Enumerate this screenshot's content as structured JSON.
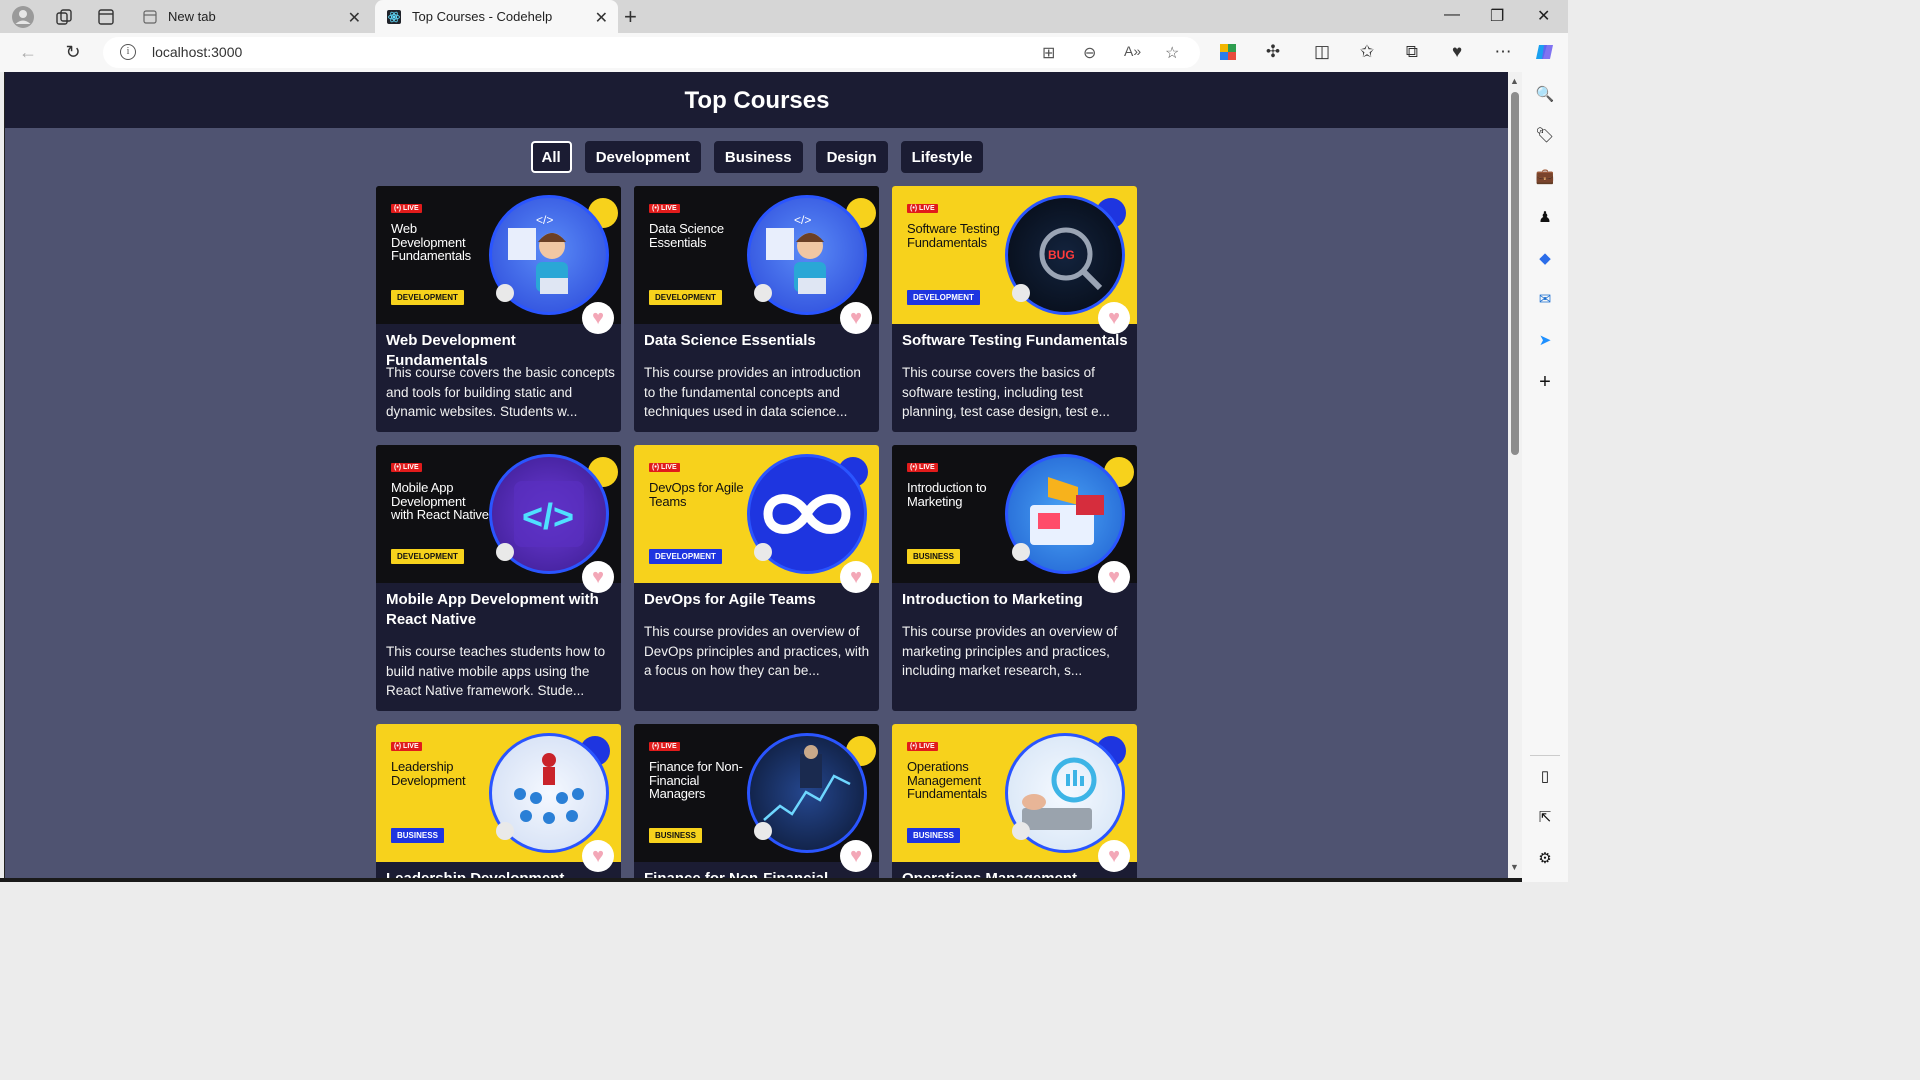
{
  "browser": {
    "tabs": [
      {
        "label": "New tab",
        "favicon": "new-tab-icon"
      },
      {
        "label": "Top Courses - Codehelp",
        "favicon": "react-icon",
        "active": true
      }
    ],
    "url": "localhost:3000"
  },
  "page": {
    "title": "Top Courses",
    "filters": [
      "All",
      "Development",
      "Business",
      "Design",
      "Lifestyle"
    ],
    "active_filter": "All",
    "live_label": "(•) LIVE",
    "like_symbol": "♥"
  },
  "courses": [
    {
      "thumb_title": "Web Development Fundamentals",
      "badge": "DEVELOPMENT",
      "title": "Web Development Fundamentals",
      "description": "This course covers the basic concepts and tools for building static and dynamic websites. Students w..."
    },
    {
      "thumb_title": "Data Science Essentials",
      "badge": "DEVELOPMENT",
      "title": "Data Science Essentials",
      "description": "This course provides an introduction to the fundamental concepts and techniques used in data science..."
    },
    {
      "thumb_title": "Software Testing Fundamentals",
      "badge": "DEVELOPMENT",
      "title": "Software Testing Fundamentals",
      "description": "This course covers the basics of software testing, including test planning, test case design, test e..."
    },
    {
      "thumb_title": "Mobile App Development with React Native",
      "badge": "DEVELOPMENT",
      "title": "Mobile App Development with React Native",
      "description": "This course teaches students how to build native mobile apps using the React Native framework. Stude..."
    },
    {
      "thumb_title": "DevOps for Agile Teams",
      "badge": "DEVELOPMENT",
      "title": "DevOps for Agile Teams",
      "description": "This course provides an overview of DevOps principles and practices, with a focus on how they can be..."
    },
    {
      "thumb_title": "Introduction to Marketing",
      "badge": "BUSINESS",
      "title": "Introduction to Marketing",
      "description": "This course provides an overview of marketing principles and practices, including market research, s..."
    },
    {
      "thumb_title": "Leadership Development",
      "badge": "BUSINESS",
      "title": "Leadership Development",
      "description": ""
    },
    {
      "thumb_title": "Finance for Non-Financial Managers",
      "badge": "BUSINESS",
      "title": "Finance for Non-Financial",
      "description": ""
    },
    {
      "thumb_title": "Operations Management Fundamentals",
      "badge": "BUSINESS",
      "title": "Operations Management",
      "description": ""
    }
  ],
  "colors": {
    "page_bg": "#4f5371",
    "header_bg": "#1b1c33",
    "card_bg": "#1b1c33",
    "thumb_yellow": "#f7d21c",
    "thumb_dark": "#0f0f12",
    "badge_blue": "#1e35e0",
    "like_pink": "#f3a7b7"
  }
}
